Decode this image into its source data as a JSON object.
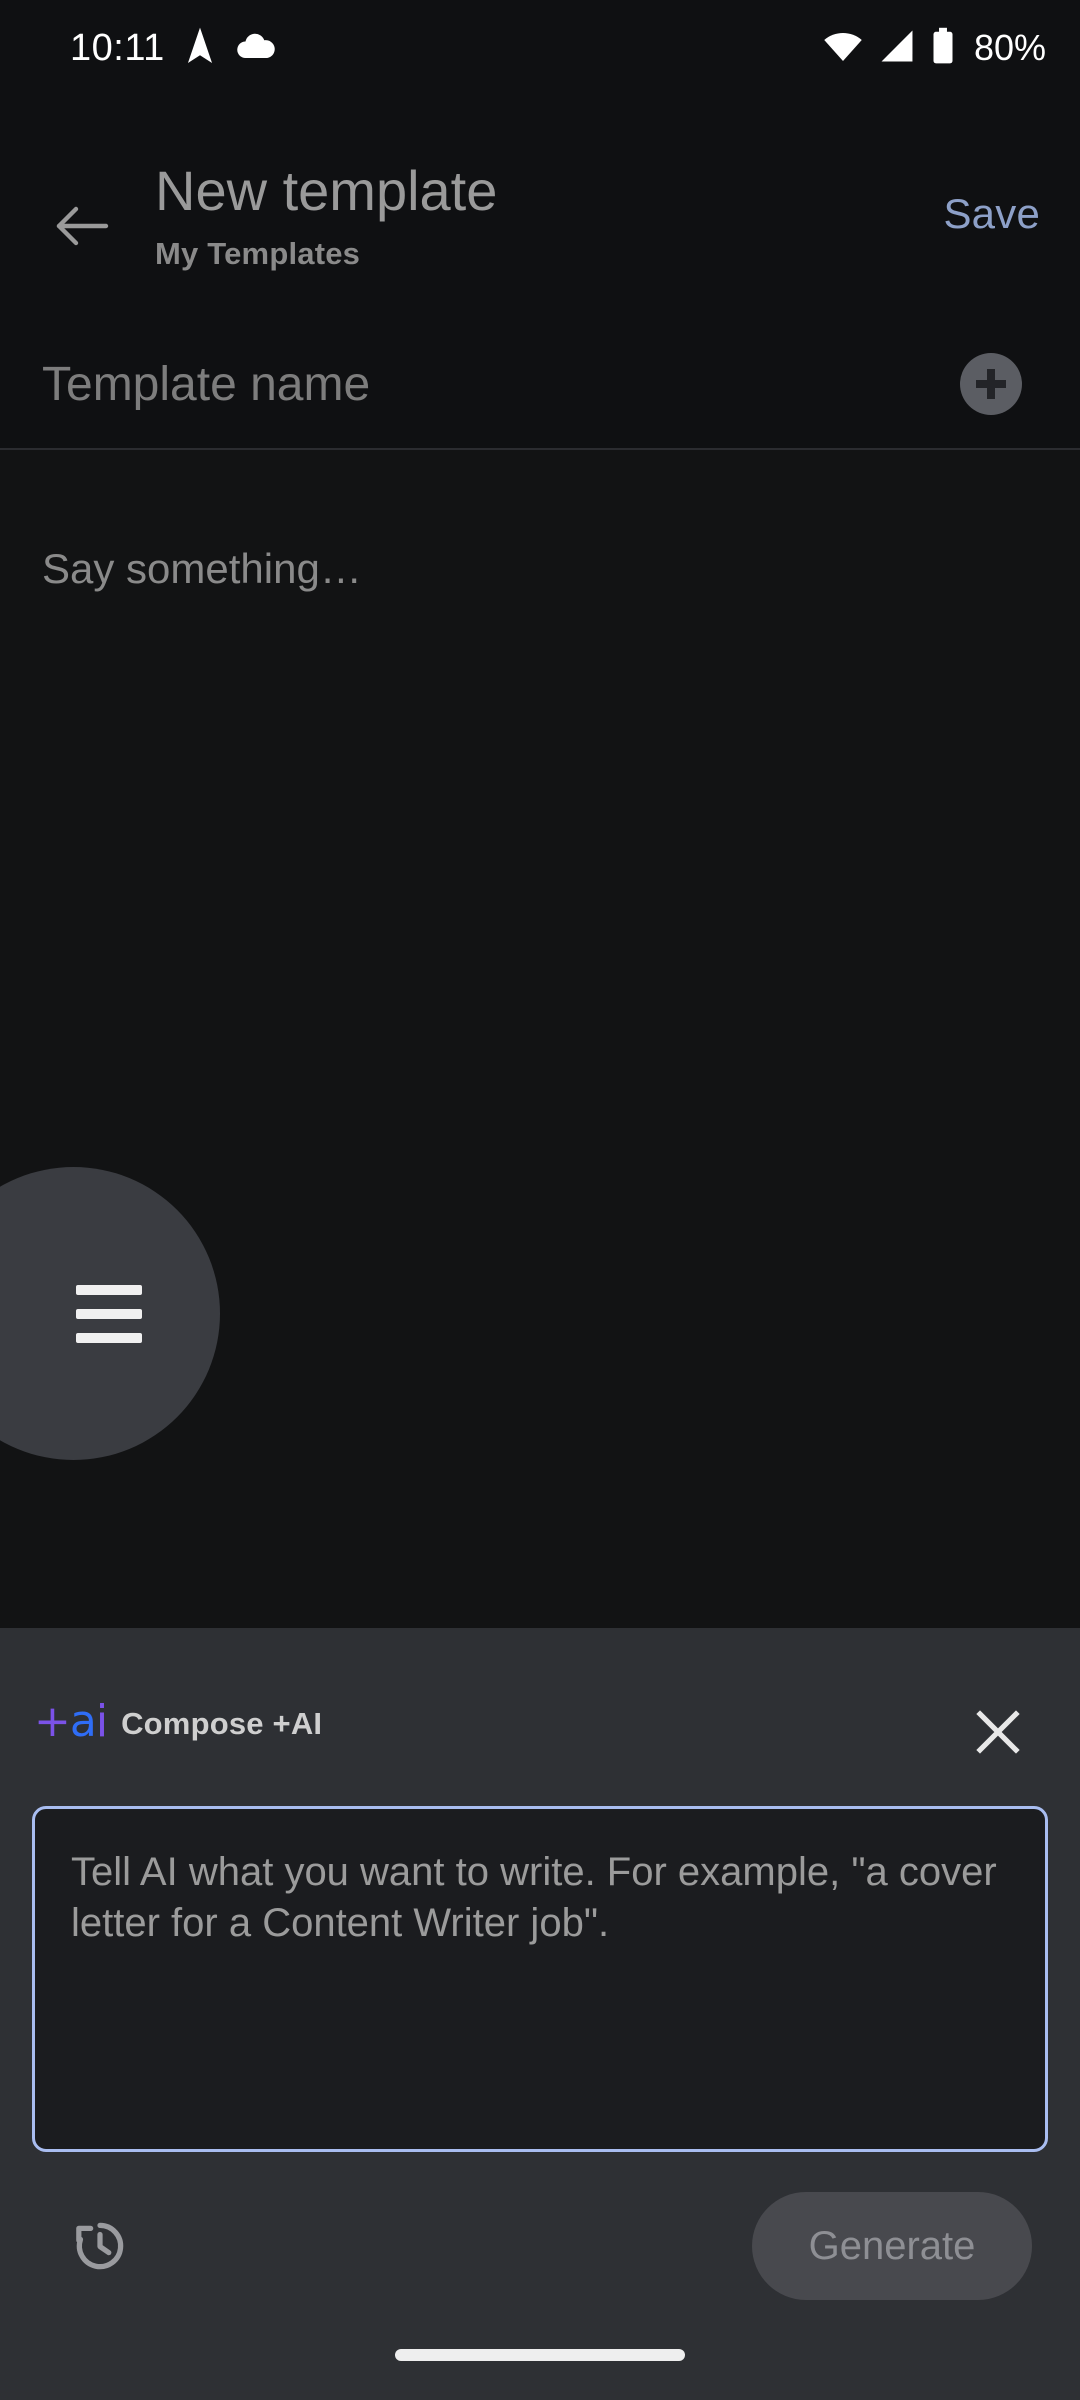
{
  "status_bar": {
    "time": "10:11",
    "battery_percent": "80%",
    "icons": {
      "navigation": "navigation-arrow-icon",
      "cloud": "cloud-icon",
      "wifi": "wifi-icon",
      "signal": "cellular-signal-icon",
      "battery": "battery-icon"
    }
  },
  "header": {
    "back_icon": "back-arrow-icon",
    "title": "New template",
    "subtitle": "My Templates",
    "save_label": "Save"
  },
  "title_field": {
    "value": "",
    "placeholder": "Template name",
    "add_icon": "plus-circle-icon"
  },
  "body_editor": {
    "value": "",
    "placeholder": "Say something…"
  },
  "fab": {
    "icon": "hamburger-menu-icon"
  },
  "ai_sheet": {
    "logo_plus": "+",
    "logo_a": "a",
    "logo_i": "i",
    "label": "Compose +AI",
    "close_icon": "close-icon",
    "prompt": {
      "value": "",
      "placeholder": "Tell AI what you want to write. For example, \"a cover letter for a Content Writer job\"."
    },
    "history_icon": "history-icon",
    "generate_label": "Generate"
  },
  "nav_bar": {
    "home_indicator": "home-indicator-pill"
  },
  "colors": {
    "app_background": "#0f1012",
    "sheet_background": "#2e3034",
    "accent_save": "#8da0c8",
    "prompt_border": "#a9bdf0",
    "logo_blue": "#2f6df6",
    "logo_purple": "#7b52e8",
    "generate_bg": "#48494e"
  }
}
